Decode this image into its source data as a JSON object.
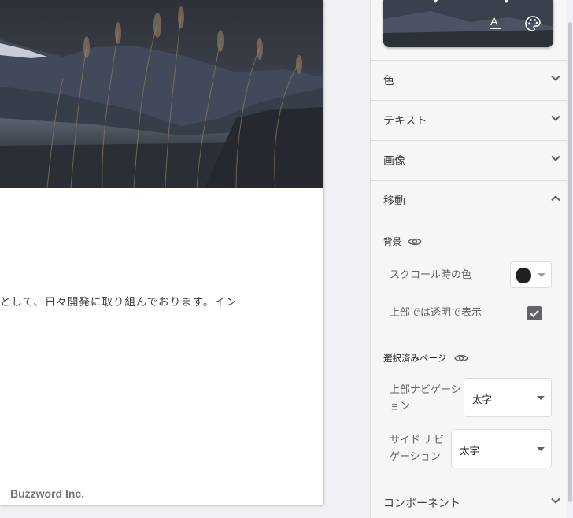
{
  "preview": {
    "body_text": "として、日々開発に取り組んでおります。イン",
    "footer_text": "Buzzword Inc."
  },
  "panel": {
    "sections": [
      {
        "label": "色",
        "expanded": false
      },
      {
        "label": "テキスト",
        "expanded": false
      },
      {
        "label": "画像",
        "expanded": false
      },
      {
        "label": "移動",
        "expanded": true
      },
      {
        "label": "コンポーネント",
        "expanded": false
      }
    ],
    "background": {
      "heading": "背景",
      "scroll_color_label": "スクロール時の色",
      "scroll_color": "#202124",
      "transparent_label": "上部では透明で表示",
      "transparent_checked": true
    },
    "selected_page": {
      "heading": "選択済みページ",
      "top_nav_label_line1": "上部ナビゲーシ",
      "top_nav_label_line2": "ョン",
      "top_nav_value": "太字",
      "side_nav_label_line1": "サイド ナビ",
      "side_nav_label_line2": "ゲーション",
      "side_nav_value": "太字"
    },
    "icons": {
      "text_color": "text-color-icon",
      "palette": "palette-icon"
    }
  }
}
